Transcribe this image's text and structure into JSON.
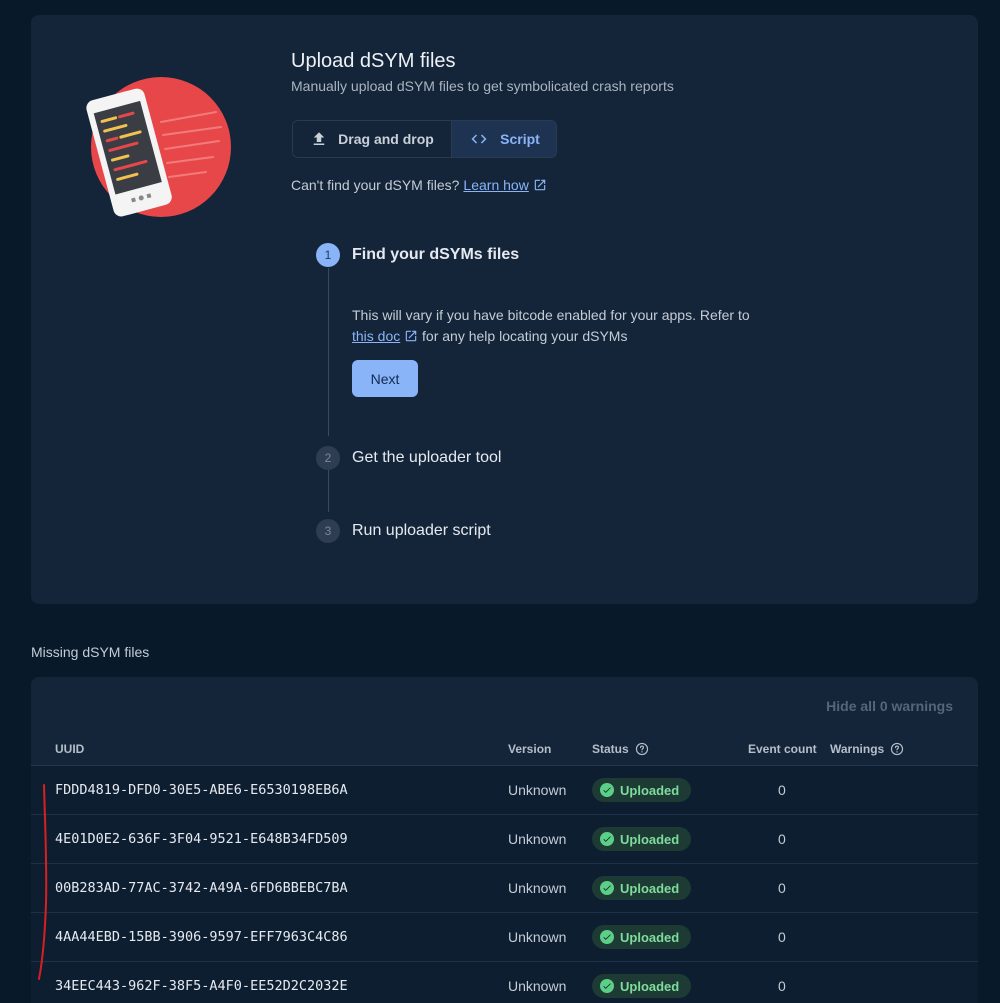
{
  "upload": {
    "title": "Upload dSYM files",
    "subtitle": "Manually upload dSYM files to get symbolicated crash reports",
    "toggle": {
      "drag_label": "Drag and drop",
      "script_label": "Script",
      "selected": "Script"
    },
    "help_prefix": "Can't find your dSYM files?",
    "help_link": "Learn how",
    "steps": [
      {
        "number": "1",
        "label": "Find your dSYMs files"
      },
      {
        "number": "2",
        "label": "Get the uploader tool"
      },
      {
        "number": "3",
        "label": "Run uploader script"
      }
    ],
    "step1_text_before": "This will vary if you have bitcode enabled for your apps. Refer to",
    "step1_link": "this doc",
    "step1_text_after": "for any help locating your dSYMs",
    "next_label": "Next"
  },
  "missing": {
    "section_title": "Missing dSYM files",
    "hide_warnings": "Hide all 0 warnings",
    "columns": {
      "uuid": "UUID",
      "version": "Version",
      "status": "Status",
      "event_count": "Event count",
      "warnings": "Warnings"
    },
    "rows": [
      {
        "uuid": "FDDD4819-DFD0-30E5-ABE6-E6530198EB6A",
        "version": "Unknown",
        "status": "Uploaded",
        "count": "0"
      },
      {
        "uuid": "4E01D0E2-636F-3F04-9521-E648B34FD509",
        "version": "Unknown",
        "status": "Uploaded",
        "count": "0"
      },
      {
        "uuid": "00B283AD-77AC-3742-A49A-6FD6BBEBC7BA",
        "version": "Unknown",
        "status": "Uploaded",
        "count": "0"
      },
      {
        "uuid": "4AA44EBD-15BB-3906-9597-EFF7963C4C86",
        "version": "Unknown",
        "status": "Uploaded",
        "count": "0"
      },
      {
        "uuid": "34EEC443-962F-38F5-A4F0-EE52D2C2032E",
        "version": "Unknown",
        "status": "Uploaded",
        "count": "0"
      }
    ]
  },
  "colors": {
    "background": "#08192a",
    "card": "#142539",
    "accent": "#8ab4f8",
    "success": "#7fdc9c",
    "hero_circle": "#e8474a"
  },
  "icons": {
    "drag": "upload-icon",
    "script": "code-icon",
    "external": "open-in-new-icon",
    "help": "help-circle-icon",
    "status": "check-circle-icon"
  }
}
